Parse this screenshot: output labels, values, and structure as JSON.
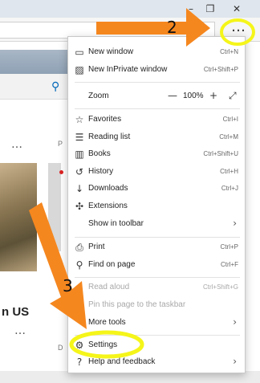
{
  "window": {
    "minimize_icon": "minimize-icon",
    "restore_icon": "restore-icon",
    "close_icon": "close-icon"
  },
  "background": {
    "dots_glyph": "…",
    "p_fragment": "P",
    "us_fragment": "n US",
    "d_fragment": "D"
  },
  "menu": {
    "more_button": "…",
    "items": [
      {
        "label": "New window",
        "shortcut": "Ctrl+N",
        "icon": "new-window-icon"
      },
      {
        "label": "New InPrivate window",
        "shortcut": "Ctrl+Shift+P",
        "icon": "inprivate-icon"
      },
      {
        "label": "Favorites",
        "shortcut": "Ctrl+I",
        "icon": "star-list-icon"
      },
      {
        "label": "Reading list",
        "shortcut": "Ctrl+M",
        "icon": "reading-list-icon"
      },
      {
        "label": "Books",
        "shortcut": "Ctrl+Shift+U",
        "icon": "books-icon"
      },
      {
        "label": "History",
        "shortcut": "Ctrl+H",
        "icon": "history-icon"
      },
      {
        "label": "Downloads",
        "shortcut": "Ctrl+J",
        "icon": "download-icon"
      },
      {
        "label": "Extensions",
        "shortcut": "",
        "icon": "extensions-icon"
      },
      {
        "label": "Show in toolbar",
        "shortcut": "",
        "icon": ""
      },
      {
        "label": "Print",
        "shortcut": "Ctrl+P",
        "icon": "print-icon"
      },
      {
        "label": "Find on page",
        "shortcut": "Ctrl+F",
        "icon": "find-icon"
      },
      {
        "label": "Read aloud",
        "shortcut": "Ctrl+Shift+G",
        "icon": ""
      },
      {
        "label": "Pin this page to the taskbar",
        "shortcut": "",
        "icon": ""
      },
      {
        "label": "More tools",
        "shortcut": "",
        "icon": ""
      },
      {
        "label": "Settings",
        "shortcut": "",
        "icon": "gear-icon"
      },
      {
        "label": "Help and feedback",
        "shortcut": "",
        "icon": "help-icon"
      }
    ],
    "zoom": {
      "label": "Zoom",
      "minus": "—",
      "value": "100%",
      "plus": "+",
      "fullscreen_icon": "fullscreen-icon"
    }
  },
  "annotations": {
    "step2": "2",
    "step3": "3",
    "arrow_color": "#f5871f",
    "highlight_color": "#f5f51a"
  }
}
